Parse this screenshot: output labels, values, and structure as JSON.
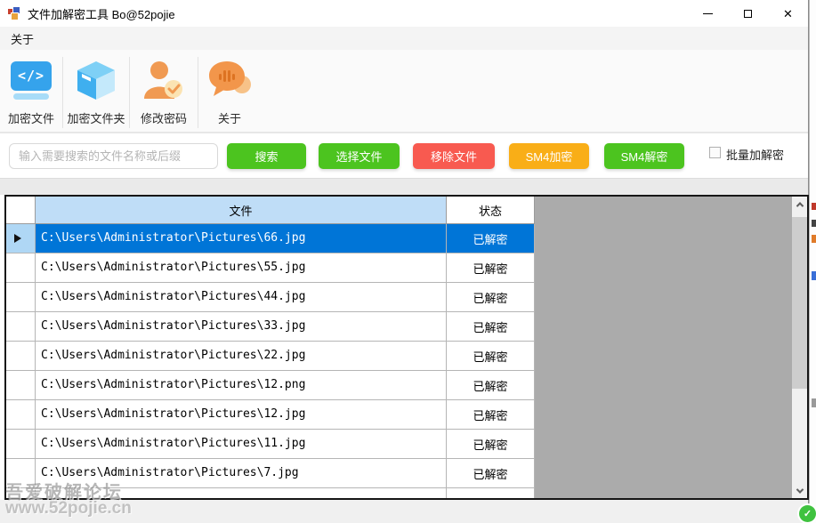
{
  "window": {
    "title": "文件加解密工具 Bo@52pojie"
  },
  "menu": {
    "about": "关于"
  },
  "toolbar": {
    "code_glyph": "</>",
    "items": [
      {
        "label": "加密文件"
      },
      {
        "label": "加密文件夹"
      },
      {
        "label": "修改密码"
      },
      {
        "label": "关于"
      }
    ]
  },
  "search": {
    "placeholder": "输入需要搜索的文件名称或后缀",
    "search_button": "搜索",
    "select_button": "选择文件",
    "remove_button": "移除文件",
    "encrypt_button": "SM4加密",
    "decrypt_button": "SM4解密",
    "batch_label": "批量加解密",
    "batch_checked": false
  },
  "grid": {
    "columns": [
      "文件",
      "状态"
    ],
    "rows": [
      {
        "file": "C:\\Users\\Administrator\\Pictures\\66.jpg",
        "status": "已解密",
        "selected": true
      },
      {
        "file": "C:\\Users\\Administrator\\Pictures\\55.jpg",
        "status": "已解密",
        "selected": false
      },
      {
        "file": "C:\\Users\\Administrator\\Pictures\\44.jpg",
        "status": "已解密",
        "selected": false
      },
      {
        "file": "C:\\Users\\Administrator\\Pictures\\33.jpg",
        "status": "已解密",
        "selected": false
      },
      {
        "file": "C:\\Users\\Administrator\\Pictures\\22.jpg",
        "status": "已解密",
        "selected": false
      },
      {
        "file": "C:\\Users\\Administrator\\Pictures\\12.png",
        "status": "已解密",
        "selected": false
      },
      {
        "file": "C:\\Users\\Administrator\\Pictures\\12.jpg",
        "status": "已解密",
        "selected": false
      },
      {
        "file": "C:\\Users\\Administrator\\Pictures\\11.jpg",
        "status": "已解密",
        "selected": false
      },
      {
        "file": "C:\\Users\\Administrator\\Pictures\\7.jpg",
        "status": "已解密",
        "selected": false
      }
    ]
  },
  "watermark": {
    "line1": "吾爱破解论坛",
    "line2": "www.52pojie.cn"
  },
  "colors": {
    "selection_blue": "#0075D7",
    "column_header_blue": "#BFDDF7",
    "button_green": "#4CC41F",
    "button_red": "#F85A50",
    "button_orange": "#F9AE17",
    "icon_blue": "#35A3EC",
    "icon_orange": "#F09A52"
  }
}
